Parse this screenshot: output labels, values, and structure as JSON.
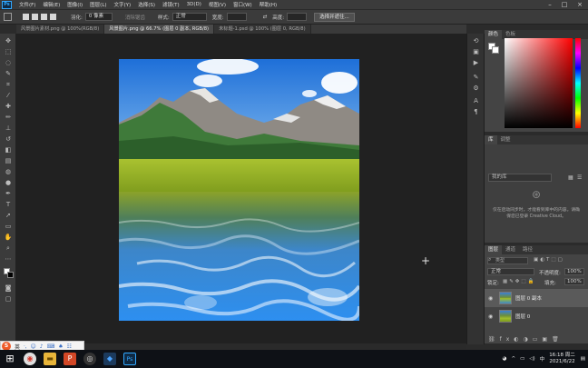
{
  "menubar": {
    "items": [
      "文件(F)",
      "编辑(E)",
      "图像(I)",
      "图层(L)",
      "文字(Y)",
      "选择(S)",
      "滤镜(T)",
      "3D(D)",
      "视图(V)",
      "窗口(W)",
      "帮助(H)"
    ]
  },
  "options": {
    "feather_label": "羽化:",
    "feather_value": "0 像素",
    "antialias_label": "消除锯齿",
    "style_label": "样式:",
    "style_value": "正常",
    "width_label": "宽度:",
    "height_label": "高度:",
    "select_mask_button": "选择并遮住..."
  },
  "tabs": [
    "风景图片素材.png @ 100%(RGB/8)",
    "风景图片.png @ 66.7% (图层 0 副本, RGB/8)",
    "未标题-1.psd @ 100% (图层 0, RGB/8)"
  ],
  "panels": {
    "color_tabs": [
      "颜色",
      "色板"
    ],
    "library_tabs": [
      "库",
      "调整"
    ],
    "library_dropdown": "我的库",
    "library_message": "仅在启动同步时，才能看到库中的内容。请确保您已登录 Creative Cloud。",
    "layers_tabs": [
      "图层",
      "通道",
      "路径"
    ],
    "search_placeholder": "类型",
    "blend_mode": "正常",
    "opacity_label": "不透明度:",
    "opacity_value": "100%",
    "lock_label": "锁定:",
    "fill_label": "填充:",
    "fill_value": "100%",
    "layers": [
      {
        "name": "图层 0 副本"
      },
      {
        "name": "图层 0"
      }
    ]
  },
  "taskbar": {
    "time": "16:18 周二",
    "date": "2021/6/22"
  },
  "ime": {
    "logo": "S",
    "mode": "英"
  }
}
